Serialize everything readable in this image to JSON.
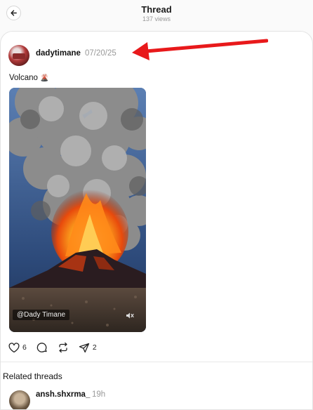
{
  "header": {
    "title": "Thread",
    "views": "137 views",
    "back_icon": "arrow-left-icon"
  },
  "post": {
    "username": "dadytimane",
    "date": "07/20/25",
    "caption": "Volcano",
    "caption_emoji": "🌋",
    "media": {
      "watermark": "@Dady Timane",
      "mute_icon": "speaker-muted-icon"
    },
    "actions": {
      "likes": "6",
      "comments_icon": "comment-icon",
      "repost_icon": "repost-icon",
      "shares": "2"
    }
  },
  "annotation": {
    "color": "#e8191b",
    "icon": "red-arrow-pointer"
  },
  "related": {
    "title": "Related threads",
    "items": [
      {
        "username": "ansh.shxrma_",
        "time": "19h"
      }
    ]
  }
}
